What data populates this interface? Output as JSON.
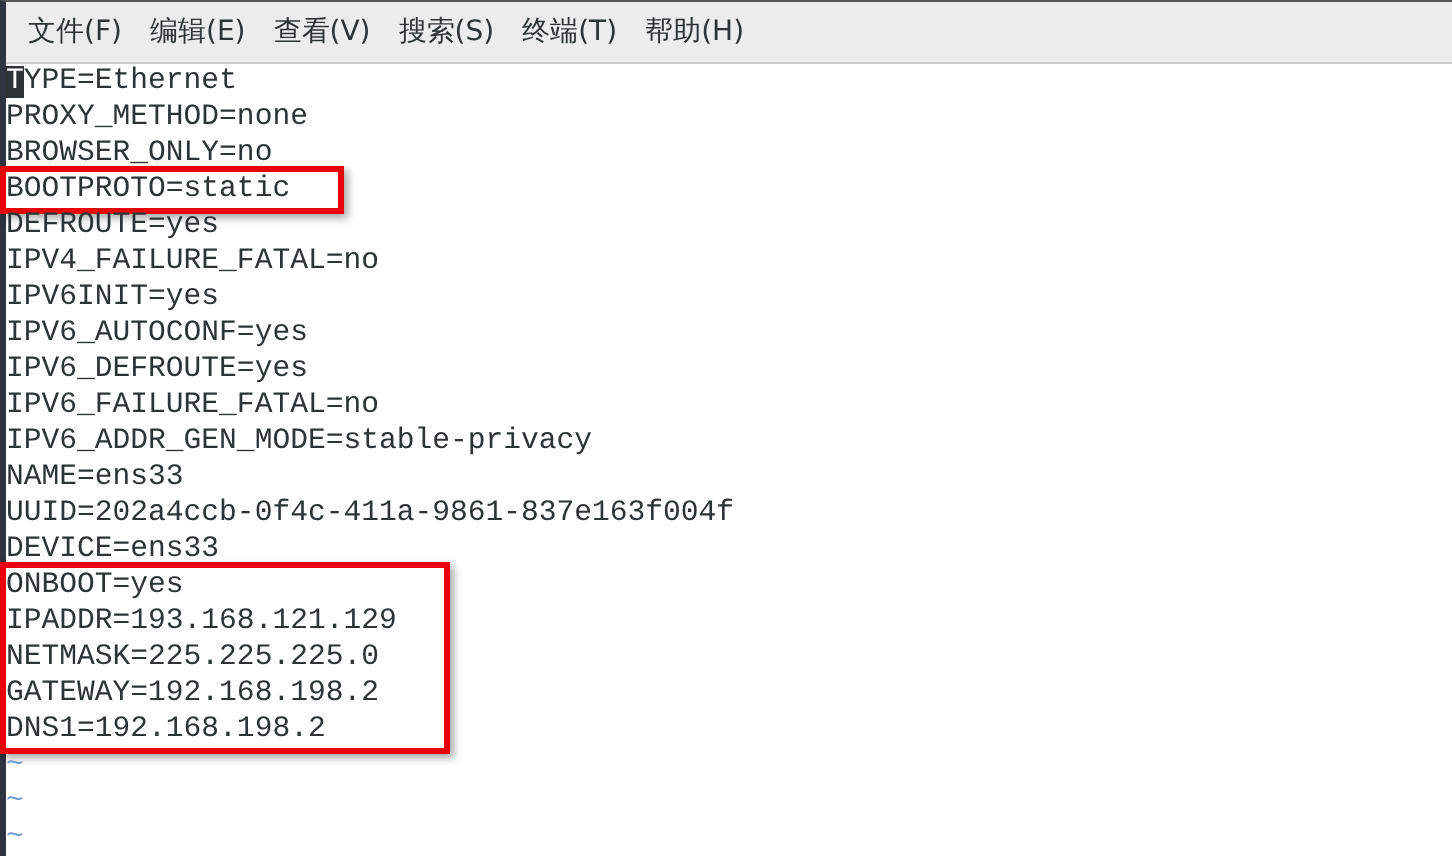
{
  "menu_bar": [
    {
      "label": "文件(F)"
    },
    {
      "label": "编辑(E)"
    },
    {
      "label": "查看(V)"
    },
    {
      "label": "搜索(S)"
    },
    {
      "label": "终端(T)"
    },
    {
      "label": "帮助(H)"
    }
  ],
  "editor": {
    "blocks": [
      {
        "highlighted": false,
        "lines": [
          {
            "text": "TYPE=Ethernet",
            "cursor": true
          },
          {
            "text": "PROXY_METHOD=none",
            "cursor": false
          },
          {
            "text": "BROWSER_ONLY=no",
            "cursor": false
          }
        ]
      },
      {
        "highlighted": true,
        "lines": [
          {
            "text": "BOOTPROTO=static",
            "cursor": false
          }
        ]
      },
      {
        "highlighted": false,
        "lines": [
          {
            "text": "DEFROUTE=yes",
            "cursor": false
          },
          {
            "text": "IPV4_FAILURE_FATAL=no",
            "cursor": false
          },
          {
            "text": "IPV6INIT=yes",
            "cursor": false
          },
          {
            "text": "IPV6_AUTOCONF=yes",
            "cursor": false
          },
          {
            "text": "IPV6_DEFROUTE=yes",
            "cursor": false
          },
          {
            "text": "IPV6_FAILURE_FATAL=no",
            "cursor": false
          },
          {
            "text": "IPV6_ADDR_GEN_MODE=stable-privacy",
            "cursor": false
          },
          {
            "text": "NAME=ens33",
            "cursor": false
          },
          {
            "text": "UUID=202a4ccb-0f4c-411a-9861-837e163f004f",
            "cursor": false
          },
          {
            "text": "DEVICE=ens33",
            "cursor": false
          }
        ]
      },
      {
        "highlighted": true,
        "lines": [
          {
            "text": "ONBOOT=yes",
            "cursor": false
          },
          {
            "text": "IPADDR=193.168.121.129",
            "cursor": false
          },
          {
            "text": "NETMASK=225.225.225.0",
            "cursor": false
          },
          {
            "text": "GATEWAY=192.168.198.2",
            "cursor": false
          },
          {
            "text": "DNS1=192.168.198.2",
            "cursor": false
          }
        ]
      }
    ],
    "filler": [
      "~",
      "~",
      "~"
    ]
  }
}
